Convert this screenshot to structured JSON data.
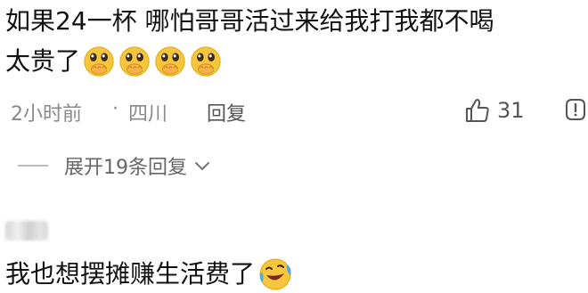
{
  "comment": {
    "line1": "如果24一杯   哪怕哥哥活过来给我打我都不喝",
    "line2": "太贵了",
    "emojis": [
      "pleading-covering-mouth-emoji",
      "pleading-covering-mouth-emoji",
      "pleading-covering-mouth-emoji",
      "pleading-covering-mouth-emoji"
    ],
    "time": "2小时前",
    "separator": "·",
    "location": "四川",
    "reply_label": "回复",
    "like_count": "31"
  },
  "expand_replies": {
    "label": "展开19条回复"
  },
  "reply": {
    "text": "我也想摆摊赚生活费了",
    "emoji": "laughing-crying-emoji"
  },
  "colors": {
    "text": "#111111",
    "meta": "#8a8a8a",
    "emoji_face": "#f7c63c"
  }
}
